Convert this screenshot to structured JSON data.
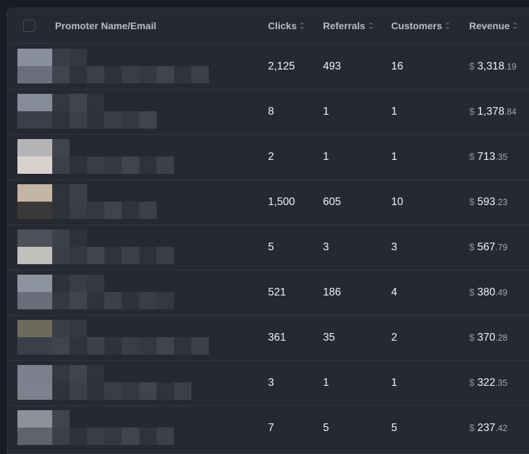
{
  "table": {
    "columns": [
      {
        "key": "promoter",
        "label": "Promoter Name/Email"
      },
      {
        "key": "clicks",
        "label": "Clicks"
      },
      {
        "key": "referrals",
        "label": "Referrals"
      },
      {
        "key": "customers",
        "label": "Customers"
      },
      {
        "key": "revenue",
        "label": "Revenue"
      }
    ],
    "currency_symbol": "$",
    "rows": [
      {
        "clicks": "2,125",
        "referrals": "493",
        "customers": "16",
        "revenue_int": "3,318",
        "revenue_dec": ".19",
        "avatar": [
          "#8a8f9e",
          "#6b6f7c"
        ]
      },
      {
        "clicks": "8",
        "referrals": "1",
        "customers": "1",
        "revenue_int": "1,378",
        "revenue_dec": ".84",
        "avatar": [
          "#878c99",
          "#3c3f49"
        ]
      },
      {
        "clicks": "2",
        "referrals": "1",
        "customers": "1",
        "revenue_int": "713",
        "revenue_dec": ".35",
        "avatar": [
          "#b5b5b8",
          "#d8d2cf"
        ]
      },
      {
        "clicks": "1,500",
        "referrals": "605",
        "customers": "10",
        "revenue_int": "593",
        "revenue_dec": ".23",
        "avatar": [
          "#c4b4a4",
          "#3b3938"
        ]
      },
      {
        "clicks": "5",
        "referrals": "3",
        "customers": "3",
        "revenue_int": "567",
        "revenue_dec": ".79",
        "avatar": [
          "#4d5058",
          "#c0c0bc"
        ]
      },
      {
        "clicks": "521",
        "referrals": "186",
        "customers": "4",
        "revenue_int": "380",
        "revenue_dec": ".49",
        "avatar": [
          "#8d929f",
          "#6a6e7b"
        ]
      },
      {
        "clicks": "361",
        "referrals": "35",
        "customers": "2",
        "revenue_int": "370",
        "revenue_dec": ".28",
        "avatar": [
          "#6e6a5a",
          "#3a3f4a"
        ]
      },
      {
        "clicks": "3",
        "referrals": "1",
        "customers": "1",
        "revenue_int": "322",
        "revenue_dec": ".35",
        "avatar": [
          "#7b808c",
          "#7d828e"
        ]
      },
      {
        "clicks": "7",
        "referrals": "5",
        "customers": "5",
        "revenue_int": "237",
        "revenue_dec": ".42",
        "avatar": [
          "#8d919c",
          "#5f636d"
        ]
      }
    ]
  },
  "colors": {
    "background": "#1a1c23",
    "panel": "#262832",
    "border": "#34363f",
    "header_text": "#b9bdc7",
    "cell_text": "#f3f4f6"
  }
}
